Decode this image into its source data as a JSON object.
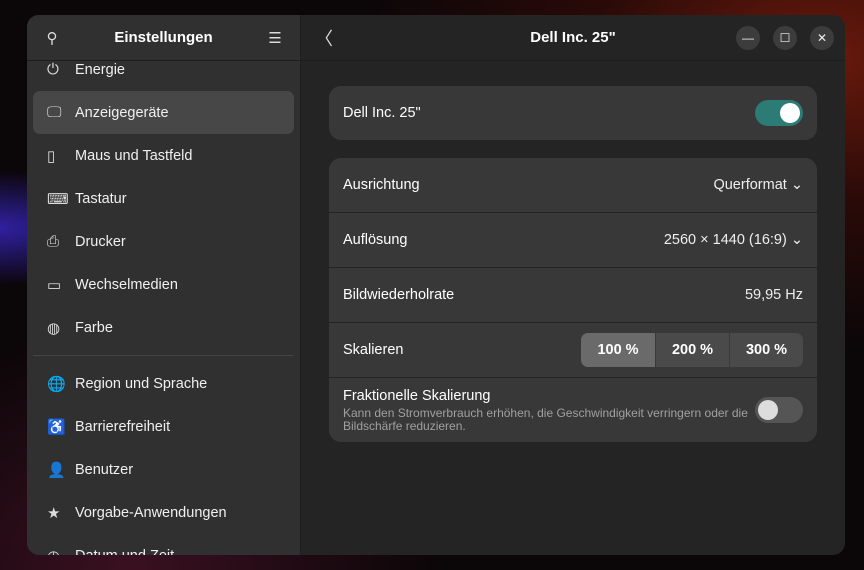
{
  "sidebar": {
    "title": "Einstellungen",
    "items": [
      {
        "label": "Energie",
        "icon": "power-icon",
        "glyph": "⏻"
      },
      {
        "label": "Anzeigegeräte",
        "icon": "display-icon",
        "glyph": "🖵"
      },
      {
        "label": "Maus und Tastfeld",
        "icon": "mouse-icon",
        "glyph": "▯"
      },
      {
        "label": "Tastatur",
        "icon": "keyboard-icon",
        "glyph": "⌨"
      },
      {
        "label": "Drucker",
        "icon": "printer-icon",
        "glyph": "⎙"
      },
      {
        "label": "Wechselmedien",
        "icon": "removable-media-icon",
        "glyph": "▭"
      },
      {
        "label": "Farbe",
        "icon": "color-icon",
        "glyph": "◍"
      },
      {
        "label": "Region und Sprache",
        "icon": "globe-icon",
        "glyph": "🌐"
      },
      {
        "label": "Barrierefreiheit",
        "icon": "accessibility-icon",
        "glyph": "♿"
      },
      {
        "label": "Benutzer",
        "icon": "users-icon",
        "glyph": "👤"
      },
      {
        "label": "Vorgabe-Anwendungen",
        "icon": "star-icon",
        "glyph": "★"
      },
      {
        "label": "Datum und Zeit",
        "icon": "clock-icon",
        "glyph": "◷"
      }
    ]
  },
  "main": {
    "title": "Dell Inc. 25\"",
    "monitor": {
      "label": "Dell Inc. 25\"",
      "enabled": true
    },
    "orientation": {
      "label": "Ausrichtung",
      "value": "Querformat"
    },
    "resolution": {
      "label": "Auflösung",
      "value": "2560 × 1440 (16:9)"
    },
    "refresh": {
      "label": "Bildwiederholrate",
      "value": "59,95 Hz"
    },
    "scale": {
      "label": "Skalieren",
      "options": [
        "100 %",
        "200 %",
        "300 %"
      ],
      "selected": "100 %"
    },
    "fractional": {
      "label": "Fraktionelle Skalierung",
      "description": "Kann den Stromverbrauch erhöhen, die Geschwindigkeit verringern oder die Bildschärfe reduzieren.",
      "enabled": false
    }
  },
  "colors": {
    "accent": "#2c7b75"
  }
}
